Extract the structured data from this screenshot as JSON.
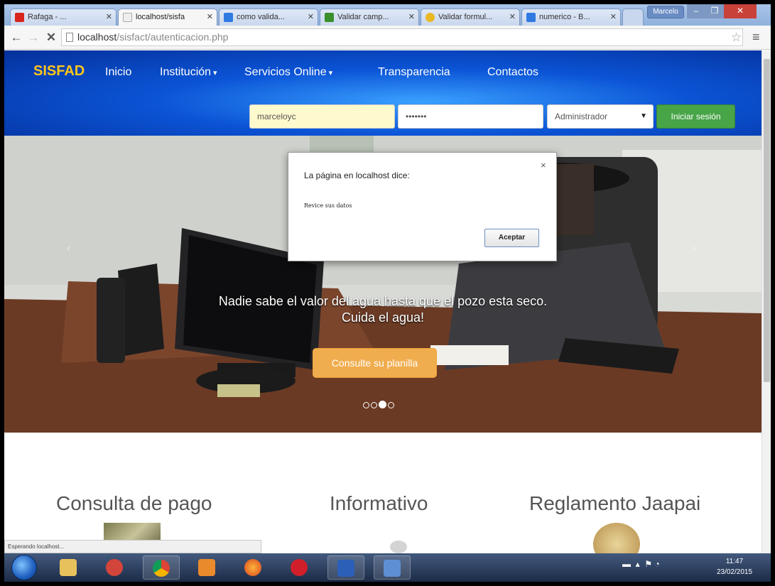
{
  "browser": {
    "tabs": [
      {
        "label": "Rafaga - ..."
      },
      {
        "label": "localhost/sisfa"
      },
      {
        "label": "como valida..."
      },
      {
        "label": "Validar camp..."
      },
      {
        "label": "Validar formul..."
      },
      {
        "label": "numerico - B..."
      }
    ],
    "profile": "Marcelo",
    "url_host": "localhost",
    "url_path": "/sisfact/autenticacion.php"
  },
  "navbar": {
    "brand": "SISFAD",
    "links": [
      "Inicio",
      "Institución",
      "Servicios Online",
      "Transparencia",
      "Contactos"
    ]
  },
  "login": {
    "username": "marceloyc",
    "password_mask": "•••••••",
    "role": "Administrador",
    "submit": "Iniciar sesión"
  },
  "carousel": {
    "caption_line1": "Nadie sabe el valor del agua hasta que el pozo esta seco.",
    "caption_line2": "Cuida el agua!",
    "cta": "Consulte su planilla",
    "slide_count": 4,
    "active_slide": 3
  },
  "dialog": {
    "title": "La página en localhost dice:",
    "message": "Revice sus datos",
    "ok": "Aceptar",
    "close": "×"
  },
  "sections": [
    "Consulta de pago",
    "Informativo",
    "Reglamento Jaapai"
  ],
  "status_bar": "Esperando localhost...",
  "taskbar": {
    "time": "11:47",
    "date": "23/02/2015"
  },
  "colors": {
    "brand": "#ffc61a",
    "login_button": "#47a447",
    "cta_button": "#f0ad4e"
  }
}
